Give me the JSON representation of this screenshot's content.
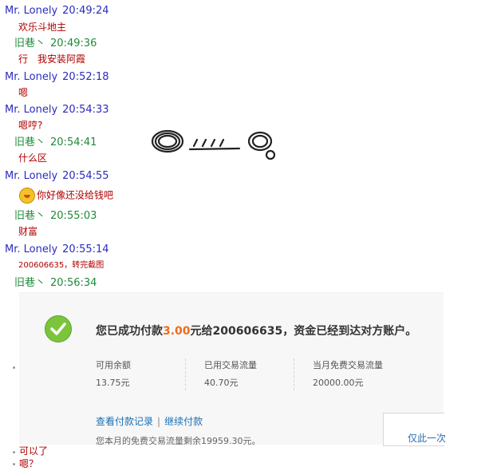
{
  "chat": {
    "messages": [
      {
        "sender": "Mr. Lonely",
        "time": "20:49:24",
        "lines": [
          "欢乐斗地主"
        ]
      },
      {
        "sender": "旧巷丶",
        "time": "20:49:36",
        "lines": [
          "行　我安装阿霞"
        ]
      },
      {
        "sender": "Mr. Lonely",
        "time": "20:52:18",
        "lines": [
          "嗯"
        ]
      },
      {
        "sender": "Mr. Lonely",
        "time": "20:54:33",
        "lines": [
          "嗯哼?"
        ]
      },
      {
        "sender": "旧巷丶",
        "time": "20:54:41",
        "lines": [
          "什么区"
        ]
      },
      {
        "sender": "Mr. Lonely",
        "time": "20:54:55",
        "lines": [
          "你好像还没给钱吧"
        ],
        "emoji": "angry-face-icon"
      },
      {
        "sender": "旧巷丶",
        "time": "20:55:03",
        "lines": [
          "财富"
        ]
      },
      {
        "sender": "Mr. Lonely",
        "time": "20:55:14",
        "lines": [
          "200606635，转完截图"
        ]
      },
      {
        "sender": "旧巷丶",
        "time": "20:56:34",
        "lines": []
      }
    ],
    "after_screenshot": [
      "可以了",
      "嗯？"
    ],
    "sticker": "doodle-face-sticker"
  },
  "payment": {
    "success_prefix": "您已成功付款",
    "amount": "3.00",
    "success_suffix": "元给200606635，资金已经到达对方账户。",
    "stats": [
      {
        "label": "可用余额",
        "value": "13.75元"
      },
      {
        "label": "已用交易流量",
        "value": "40.70元"
      },
      {
        "label": "当月免费交易流量",
        "value": "20000.00元"
      }
    ],
    "link_records": "查看付款记录",
    "link_separator": "|",
    "link_continue": "继续付款",
    "note": "您本月的免费交易流量剩余19959.30元。",
    "side_text": "仅此一次"
  },
  "colors": {
    "sender_lonely": "#2b2bbf",
    "sender_other": "#1f8a3a",
    "message": "#b00000",
    "amount": "#f06b1c",
    "link": "#1a6fb5"
  }
}
